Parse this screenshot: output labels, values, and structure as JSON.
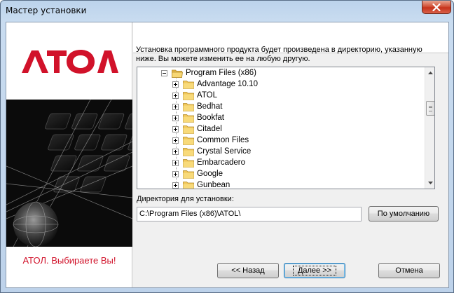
{
  "window": {
    "title": "Мастер установки"
  },
  "banner": {
    "logo_text": "АТОЛ",
    "slogan": "АТОЛ. Выбираете Вы!"
  },
  "content": {
    "description": "Установка программного продукта будет произведена в директорию, указанную ниже. Вы можете изменить ее на любую другую.",
    "tree": {
      "root": "Program Files (x86)",
      "children": [
        "Advantage 10.10",
        "ATOL",
        "Bedhat",
        "Bookfat",
        "Citadel",
        "Common Files",
        "Crystal Service",
        "Embarcadero",
        "Google",
        "Gunbean"
      ]
    },
    "dir_label": "Директория для установки:",
    "dir_value": "C:\\Program Files (x86)\\ATOL\\",
    "default_button": "По умолчанию"
  },
  "buttons": {
    "back": "<< Назад",
    "next": "Далее >>",
    "cancel": "Отмена"
  },
  "colors": {
    "brand_red": "#d1122a"
  }
}
